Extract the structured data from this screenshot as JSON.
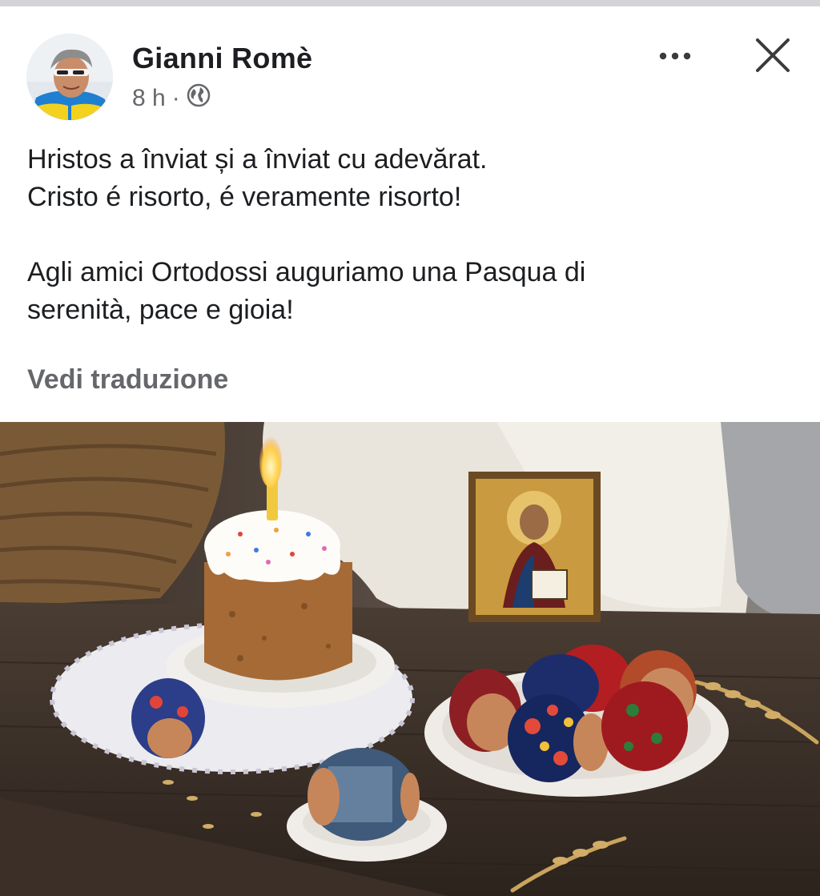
{
  "post": {
    "author_name": "Gianni Romè",
    "time": "8 h",
    "separator": "·",
    "audience_icon": "globe-icon",
    "message_lines": [
      "Hristos a înviat și a înviat cu adevărat.",
      "Cristo é risorto, é veramente risorto!"
    ],
    "message_paragraph_2_lines": [
      "Agli amici Ortodossi auguriamo una Pasqua di",
      "serenità, pace e gioia!"
    ],
    "translate_label": "Vedi traduzione"
  },
  "actions": {
    "more_icon": "more-options-icon",
    "close_icon": "close-icon"
  },
  "colors": {
    "text_primary": "#1c1e21",
    "text_secondary": "#65676b",
    "top_bar": "#d3d4d8"
  }
}
